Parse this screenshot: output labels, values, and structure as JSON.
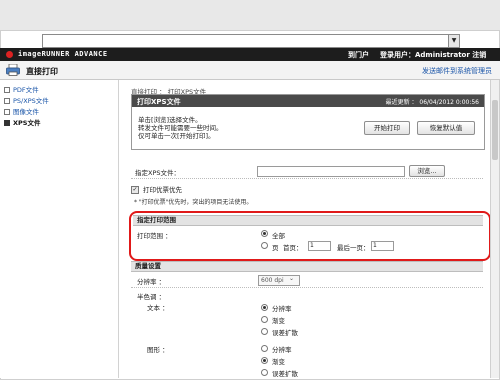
{
  "brand": {
    "name": "imageRUNNER ADVANCE",
    "portal": "到门户",
    "login_user": "登录用户：Administrator 注销"
  },
  "page": {
    "title": "直接打印",
    "admin_link": "发送邮件到系统管理员"
  },
  "sidebar": {
    "items": [
      {
        "label": "PDF文件",
        "active": false
      },
      {
        "label": "PS/XPS文件",
        "active": false
      },
      {
        "label": "图像文件",
        "active": false
      },
      {
        "label": "XPS文件",
        "active": true
      }
    ]
  },
  "main": {
    "breadcrumb": "直接打印 ： 打印XPS文件",
    "panel": {
      "title": "打印XPS文件",
      "last_updated": "最近更新 ： 06/04/2012 0:00:56",
      "message_lines": [
        "单击[浏览]选择文件。",
        "转发文件可能需要一些时间。",
        "仅可单击一次[开始打印]。"
      ],
      "start_button": "开始打印",
      "default_button": "恢复默认值"
    },
    "file": {
      "label": "指定XPS文件：",
      "browse_button": "浏览..."
    },
    "priority": {
      "label": "打印优票优先",
      "checked": true
    },
    "note": "* \"打印优票\"优先时，突出的项目无法使用。",
    "print_range": {
      "section": "指定打印范围",
      "label": "打印范围 ：",
      "options": [
        "全部",
        "页"
      ],
      "selected": "全部",
      "first_page_label": "首页：",
      "first_page_value": "1",
      "last_page_label": "最后一页：",
      "last_page_value": "1"
    },
    "quality": {
      "section": "质量设置",
      "resolution_label": "分辨率 ：",
      "resolution_value": "600 dpi",
      "half_tone_label": "半色调 ：",
      "text_label": "文本 ：",
      "text_options": [
        "分辨率",
        "渐变",
        "误差扩散"
      ],
      "text_selected": "分辨率",
      "graphics_label": "图形 ：",
      "graphics_options": [
        "分辨率",
        "渐变",
        "误差扩散"
      ],
      "graphics_selected": "渐变"
    }
  },
  "colors": {
    "highlight": "#e01919",
    "brand_bar": "#1d1d1d",
    "link": "#1a55a8"
  }
}
